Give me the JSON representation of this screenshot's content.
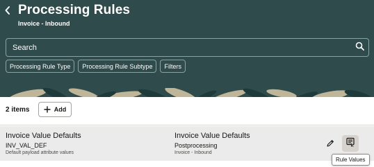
{
  "header": {
    "title": "Processing Rules",
    "subtitle": "Invoice - Inbound"
  },
  "search": {
    "placeholder": "Search"
  },
  "filters": [
    {
      "label": "Processing Rule Type"
    },
    {
      "label": "Processing Rule Subtype"
    },
    {
      "label": "Filters"
    }
  ],
  "toolbar": {
    "count": "2 items",
    "add_label": "Add"
  },
  "rows": [
    {
      "name": "Invoice Value Defaults",
      "code": "INV_VAL_DEF",
      "description": "Default payload attribute values",
      "type_name": "Invoice Value Defaults",
      "subtype": "Postprocessing",
      "direction": "Invoice - Inbound"
    }
  ],
  "tooltip": {
    "text": "Rule Values"
  },
  "icons": {
    "back": "chevron-left-icon",
    "search": "search-icon",
    "add": "plus-icon",
    "edit": "pencil-icon",
    "rule_values": "rule-values-icon"
  },
  "colors": {
    "header_bg": "#2f4b4b",
    "row_bg": "#ebebeb",
    "decor_leaf_dark": "#1f3a3a",
    "decor_leaf_light": "#d9c9a8"
  }
}
